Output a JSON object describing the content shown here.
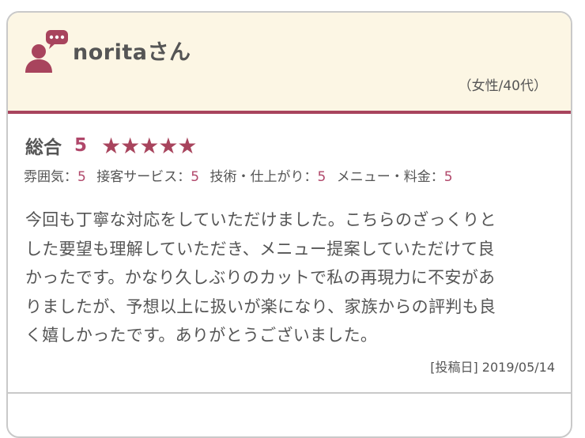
{
  "review": {
    "reviewer_name": "noritaさん",
    "reviewer_info": "（女性/40代）",
    "overall_label": "総合",
    "overall_score": "5",
    "stars": "★★★★★",
    "rating": 5,
    "sub_ratings": [
      {
        "label": "雰囲気：",
        "value": "5"
      },
      {
        "label": "接客サービス：",
        "value": "5"
      },
      {
        "label": "技術・仕上がり：",
        "value": "5"
      },
      {
        "label": "メニュー・料金：",
        "value": "5"
      }
    ],
    "comment_lines": [
      "今回も丁寧な対応をしていただけました。こちらのざっくりと",
      "した要望も理解していただき、メニュー提案していただけて良",
      "かったです。かなり久しぶりのカットで私の再現力に不安があ",
      "りましたが、予想以上に扱いが楽になり、家族からの評判も良",
      "く嬉しかったです。ありがとうございました。"
    ],
    "posted_date": "[投稿日] 2019/05/14"
  },
  "colors": {
    "accent": "#a8445d",
    "header_bg": "#fcf6e4",
    "text": "#555555"
  },
  "icons": {
    "avatar": "user-comment-icon"
  }
}
